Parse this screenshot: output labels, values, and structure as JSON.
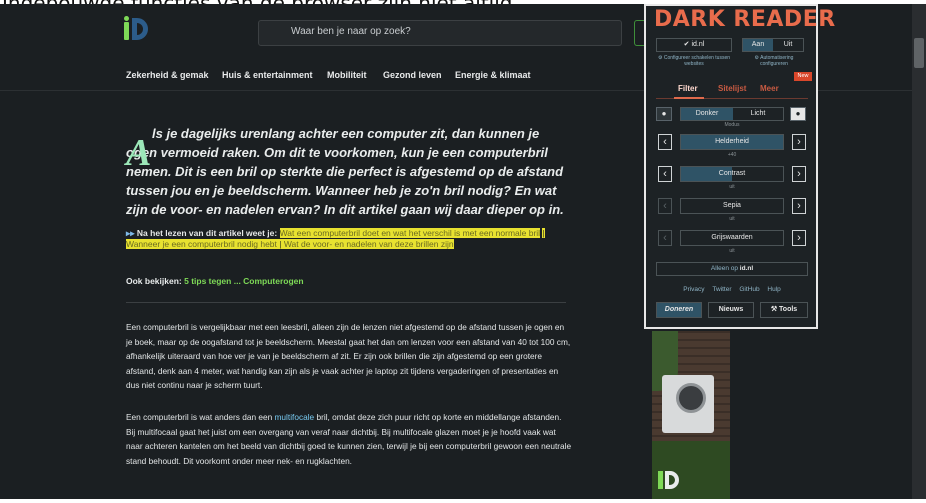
{
  "caption": "Ingebouwde functies van de browser zijn niet altijd",
  "header": {
    "search_placeholder": "Waar ben je naar op zoek?"
  },
  "nav": [
    "Zekerheid & gemak",
    "Huis & entertainment",
    "Mobiliteit",
    "Gezond leven",
    "Energie & klimaat"
  ],
  "article": {
    "dropcap": "A",
    "intro": "ls je dagelijks urenlang achter een computer zit, dan kunnen je ogen vermoeid raken. Om dit te voorkomen, kun je een computerbril nemen. Dit is een bril op sterkte die perfect is afgestemd op de afstand tussen jou en je beeldscherm. Wanneer heb je zo'n bril nodig? En wat zijn de voor- en nadelen ervan? In dit artikel gaan wij daar dieper op in.",
    "toc_prefix": "▸▸",
    "toc_label": "Na het lezen van dit artikel weet je:",
    "toc_items": [
      "Wat een computerbril doet en wat het verschil is met een normale bril",
      "Wanneer je een computerbril nodig hebt",
      "Wat de voor- en nadelen van deze brillen zijn"
    ],
    "also_label": "Ook bekijken:",
    "also_link": "5 tips tegen ... Computerogen",
    "para1": "Een computerbril is vergelijkbaar met een leesbril, alleen zijn de lenzen niet afgestemd op de afstand tussen je ogen en je boek, maar op de oogafstand tot je beeldscherm. Meestal gaat het dan om lenzen voor een afstand van 40 tot 100 cm, afhankelijk uiteraard van hoe ver je van je beeldscherm af zit. Er zijn ook brillen die zijn afgestemd op een grotere afstand, denk aan 4 meter, wat handig kan zijn als je vaak achter je laptop zit tijdens vergaderingen of presentaties en dus niet continu naar je scherm tuurt.",
    "para2_a": "Een computerbril is wat anders dan een ",
    "para2_link": "multifocale",
    "para2_b": " bril, omdat deze zich puur richt op korte en middellange afstanden. Bij multifocaal gaat het juist om een overgang van veraf naar dichtbij. Bij multifocale glazen moet je je hoofd vaak wat naar achteren kantelen om het beeld van dichtbij goed te kunnen zien, terwijl je bij een computerbril gewoon een neutrale stand behoudt. Dit voorkomt onder meer nek- en rugklachten."
  },
  "darkreader": {
    "title": "DARK READER",
    "site": "✔ id.nl",
    "on": "Aan",
    "off": "Uit",
    "hint_left": "⚙ Configureer schakelen tussen websites",
    "hint_right": "⚙ Automatisering configureren",
    "new_badge": "New",
    "tabs": [
      "Filter",
      "Sitelijst",
      "Meer"
    ],
    "mode_dark": "Donker",
    "mode_light": "Licht",
    "mode_label": "Modus",
    "sliders": [
      {
        "label": "Helderheid",
        "value": "+40",
        "fill": 1.0
      },
      {
        "label": "Contrast",
        "value": "uit",
        "fill": 0.5
      },
      {
        "label": "Sepia",
        "value": "uit",
        "fill": 0
      },
      {
        "label": "Grijswaarden",
        "value": "uit",
        "fill": 0
      }
    ],
    "site_only_prefix": "Alleen op ",
    "site_only_site": "id.nl",
    "links": [
      "Privacy",
      "Twitter",
      "GitHub",
      "Hulp"
    ],
    "donate": "Doneren",
    "news": "Nieuws",
    "tools": "⚒ Tools"
  }
}
